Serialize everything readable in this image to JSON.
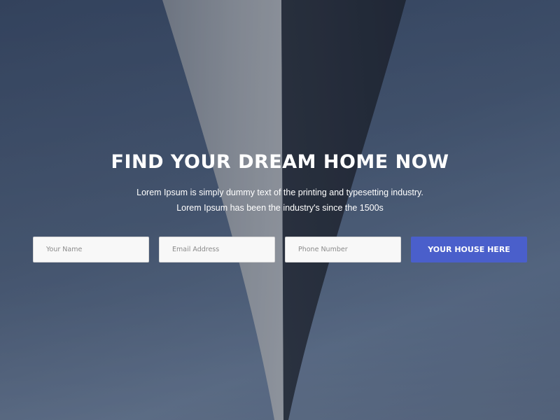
{
  "hero": {
    "title": "FIND YOUR DREAM HOME NOW",
    "subtitle_line1": "Lorem Ipsum is simply dummy text of the printing and typesetting industry.",
    "subtitle_line2": "Lorem Ipsum has been the industry's since the 1500s"
  },
  "form": {
    "name_placeholder": "Your Name",
    "email_placeholder": "Email Address",
    "phone_placeholder": "Phone Number",
    "submit_label": "YOUR HOUSE HERE"
  },
  "colors": {
    "accent": "#4a5fcb",
    "sky": "#475a76"
  }
}
